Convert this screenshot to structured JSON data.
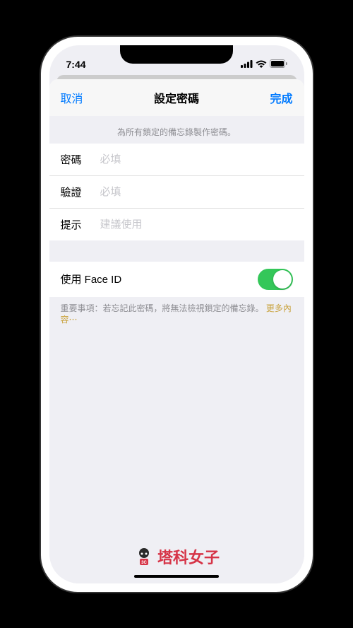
{
  "statusBar": {
    "time": "7:44"
  },
  "modal": {
    "cancel": "取消",
    "title": "設定密碼",
    "done": "完成"
  },
  "sectionHeader": "為所有鎖定的備忘錄製作密碼。",
  "form": {
    "password": {
      "label": "密碼",
      "placeholder": "必填"
    },
    "verify": {
      "label": "驗證",
      "placeholder": "必填"
    },
    "hint": {
      "label": "提示",
      "placeholder": "建議使用"
    }
  },
  "faceId": {
    "label": "使用 Face ID",
    "enabled": true
  },
  "footer": {
    "prefix": "重要事項：",
    "text": "若忘記此密碼，將無法檢視鎖定的備忘錄。",
    "link": "更多內容⋯"
  },
  "watermark": {
    "text": "塔科女子"
  }
}
